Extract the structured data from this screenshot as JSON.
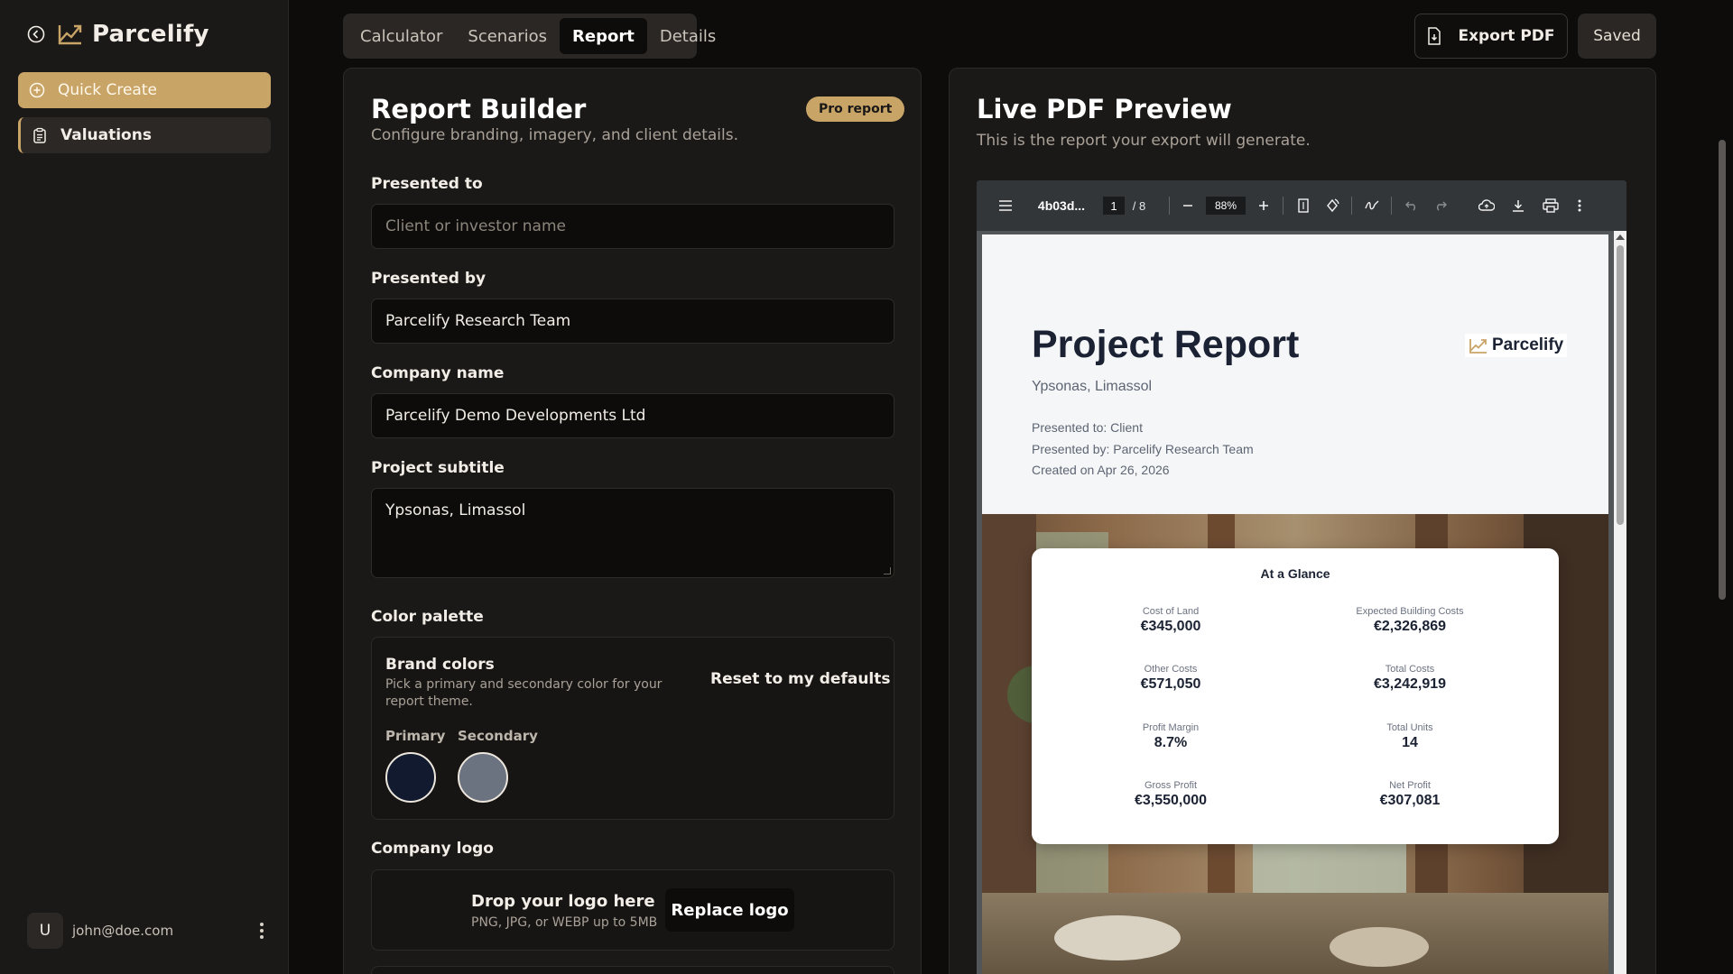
{
  "sidebar": {
    "brand": "Parcelify",
    "items": [
      {
        "label": "Quick Create",
        "icon": "plus-circle-icon"
      },
      {
        "label": "Valuations",
        "icon": "clipboard-icon"
      }
    ],
    "user": {
      "initial": "U",
      "email": "john@doe.com"
    }
  },
  "topbar": {
    "tabs": [
      "Calculator",
      "Scenarios",
      "Report",
      "Details"
    ],
    "active_tab": "Report",
    "export_label": "Export PDF",
    "saved_label": "Saved"
  },
  "builder": {
    "title": "Report Builder",
    "subtitle": "Configure branding, imagery, and client details.",
    "badge": "Pro report",
    "presented_to": {
      "label": "Presented to",
      "value": "",
      "placeholder": "Client or investor name"
    },
    "presented_by": {
      "label": "Presented by",
      "value": "Parcelify Research Team"
    },
    "company_name": {
      "label": "Company name",
      "value": "Parcelify Demo Developments Ltd"
    },
    "project_subtitle": {
      "label": "Project subtitle",
      "value": "Ypsonas, Limassol"
    },
    "palette": {
      "heading": "Color palette",
      "title": "Brand colors",
      "description": "Pick a primary and secondary color for your report theme.",
      "reset_label": "Reset to my defaults",
      "primary_label": "Primary",
      "secondary_label": "Secondary",
      "primary_color": "#111a2e",
      "secondary_color": "#6b7280"
    },
    "logo": {
      "heading": "Company logo",
      "title": "Drop your logo here",
      "subtitle": "PNG, JPG, or WEBP up to 5MB",
      "button": "Replace logo"
    }
  },
  "preview": {
    "title": "Live PDF Preview",
    "subtitle": "This is the report your export will generate.",
    "toolbar": {
      "filename": "4b03d...",
      "page": "1",
      "page_total": "/  8",
      "zoom": "88%"
    },
    "report": {
      "title": "Project Report",
      "subtitle": "Ypsonas, Limassol",
      "presented_to": "Presented to: Client",
      "presented_by": "Presented by: Parcelify Research Team",
      "created": "Created on Apr 26, 2026",
      "logo_text": "Parcelify",
      "glance": {
        "title": "At a Glance",
        "items": [
          {
            "label": "Cost of Land",
            "value": "€345,000"
          },
          {
            "label": "Expected Building Costs",
            "value": "€2,326,869"
          },
          {
            "label": "Other Costs",
            "value": "€571,050"
          },
          {
            "label": "Total Costs",
            "value": "€3,242,919"
          },
          {
            "label": "Profit Margin",
            "value": "8.7%"
          },
          {
            "label": "Total Units",
            "value": "14"
          },
          {
            "label": "Gross Profit",
            "value": "€3,550,000"
          },
          {
            "label": "Net Profit",
            "value": "€307,081"
          }
        ]
      }
    }
  },
  "colors": {
    "accent": "#c9a467",
    "background": "#0d0c0b",
    "panel": "#1b1918"
  }
}
